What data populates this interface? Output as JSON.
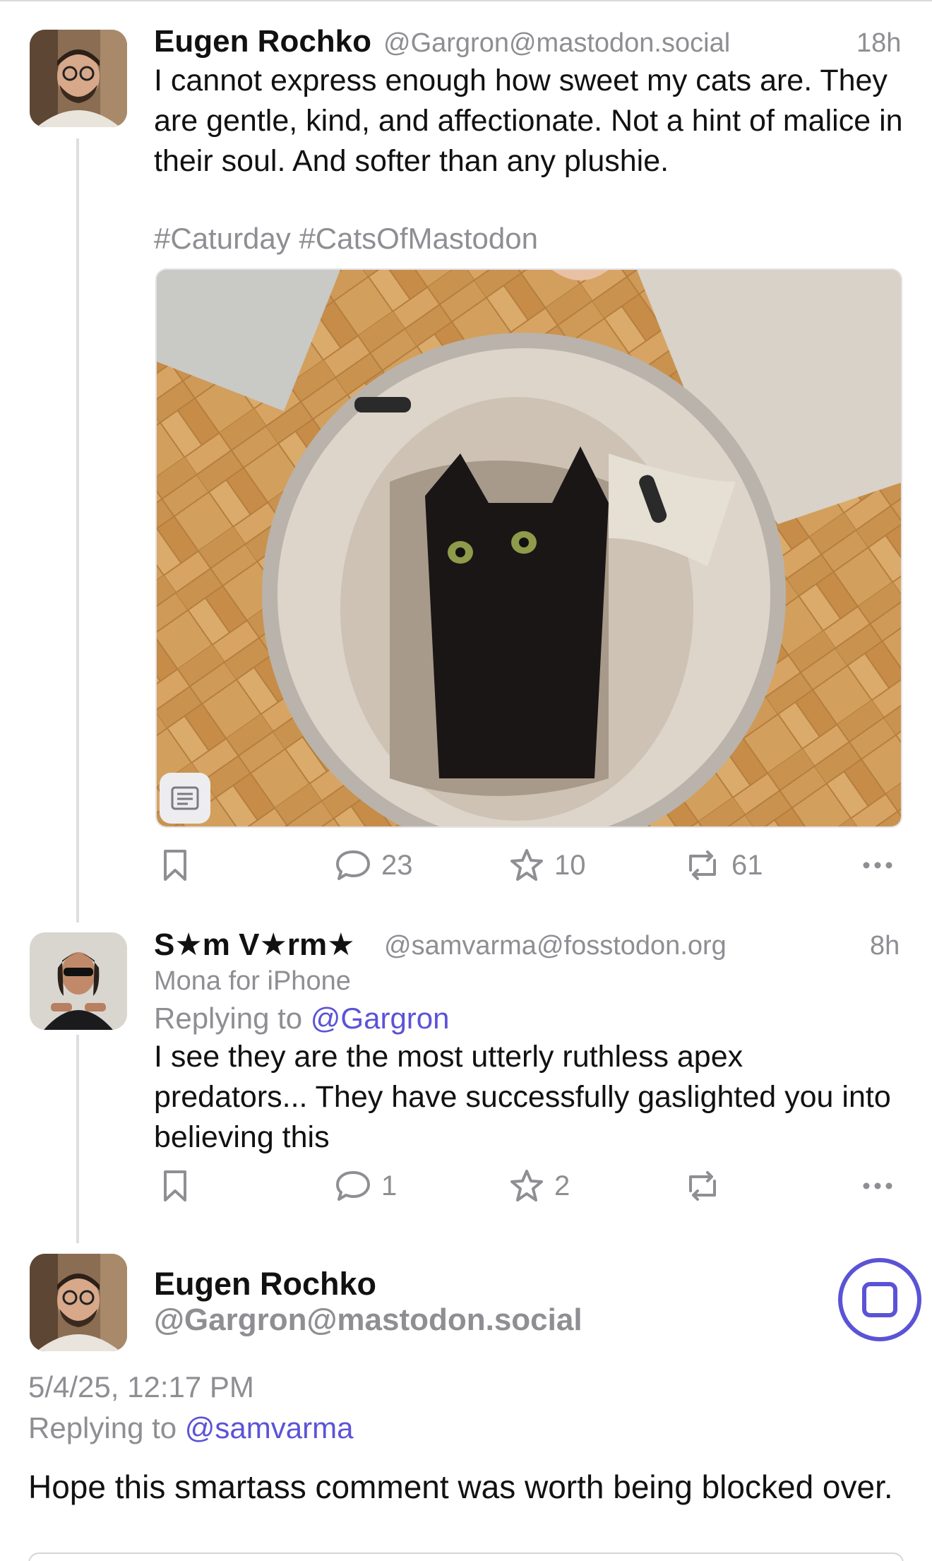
{
  "posts": [
    {
      "author": "Eugen Rochko",
      "handle": "@Gargron@mastodon.social",
      "time": "18h",
      "text": "I cannot express enough how sweet my cats are. They are gentle, kind, and affectionate. Not a hint of malice in their soul. And softer than any plushie.",
      "hashtags": "#Caturday #CatsOfMastodon",
      "replies": "23",
      "favourites": "10",
      "boosts": "61"
    },
    {
      "author": "S★m V★rm★",
      "handle": "@samvarma@fosstodon.org",
      "time": "8h",
      "client": "Mona for iPhone",
      "replying_prefix": "Replying to ",
      "replying_to": "@Gargron",
      "text": "I see they are the most utterly ruthless apex predators... They have successfully gaslighted you into believing this",
      "replies": "1",
      "favourites": "2",
      "boosts": ""
    }
  ],
  "focused": {
    "author": "Eugen Rochko",
    "handle": "@Gargron@mastodon.social",
    "datetime": "5/4/25, 12:17 PM",
    "replying_prefix": "Replying to ",
    "replying_to": "@samvarma",
    "text": "Hope this smartass comment was worth being blocked over."
  },
  "icons": {
    "bookmark": "bookmark-icon",
    "reply": "reply-icon",
    "favourite": "star-icon",
    "boost": "boost-icon",
    "more": "more-icon",
    "alt": "alt-text-icon",
    "stop": "stop-icon"
  },
  "colors": {
    "accent": "#5b53d6",
    "muted": "#8e8e93",
    "text": "#111111",
    "thread_line": "#dedee2"
  }
}
